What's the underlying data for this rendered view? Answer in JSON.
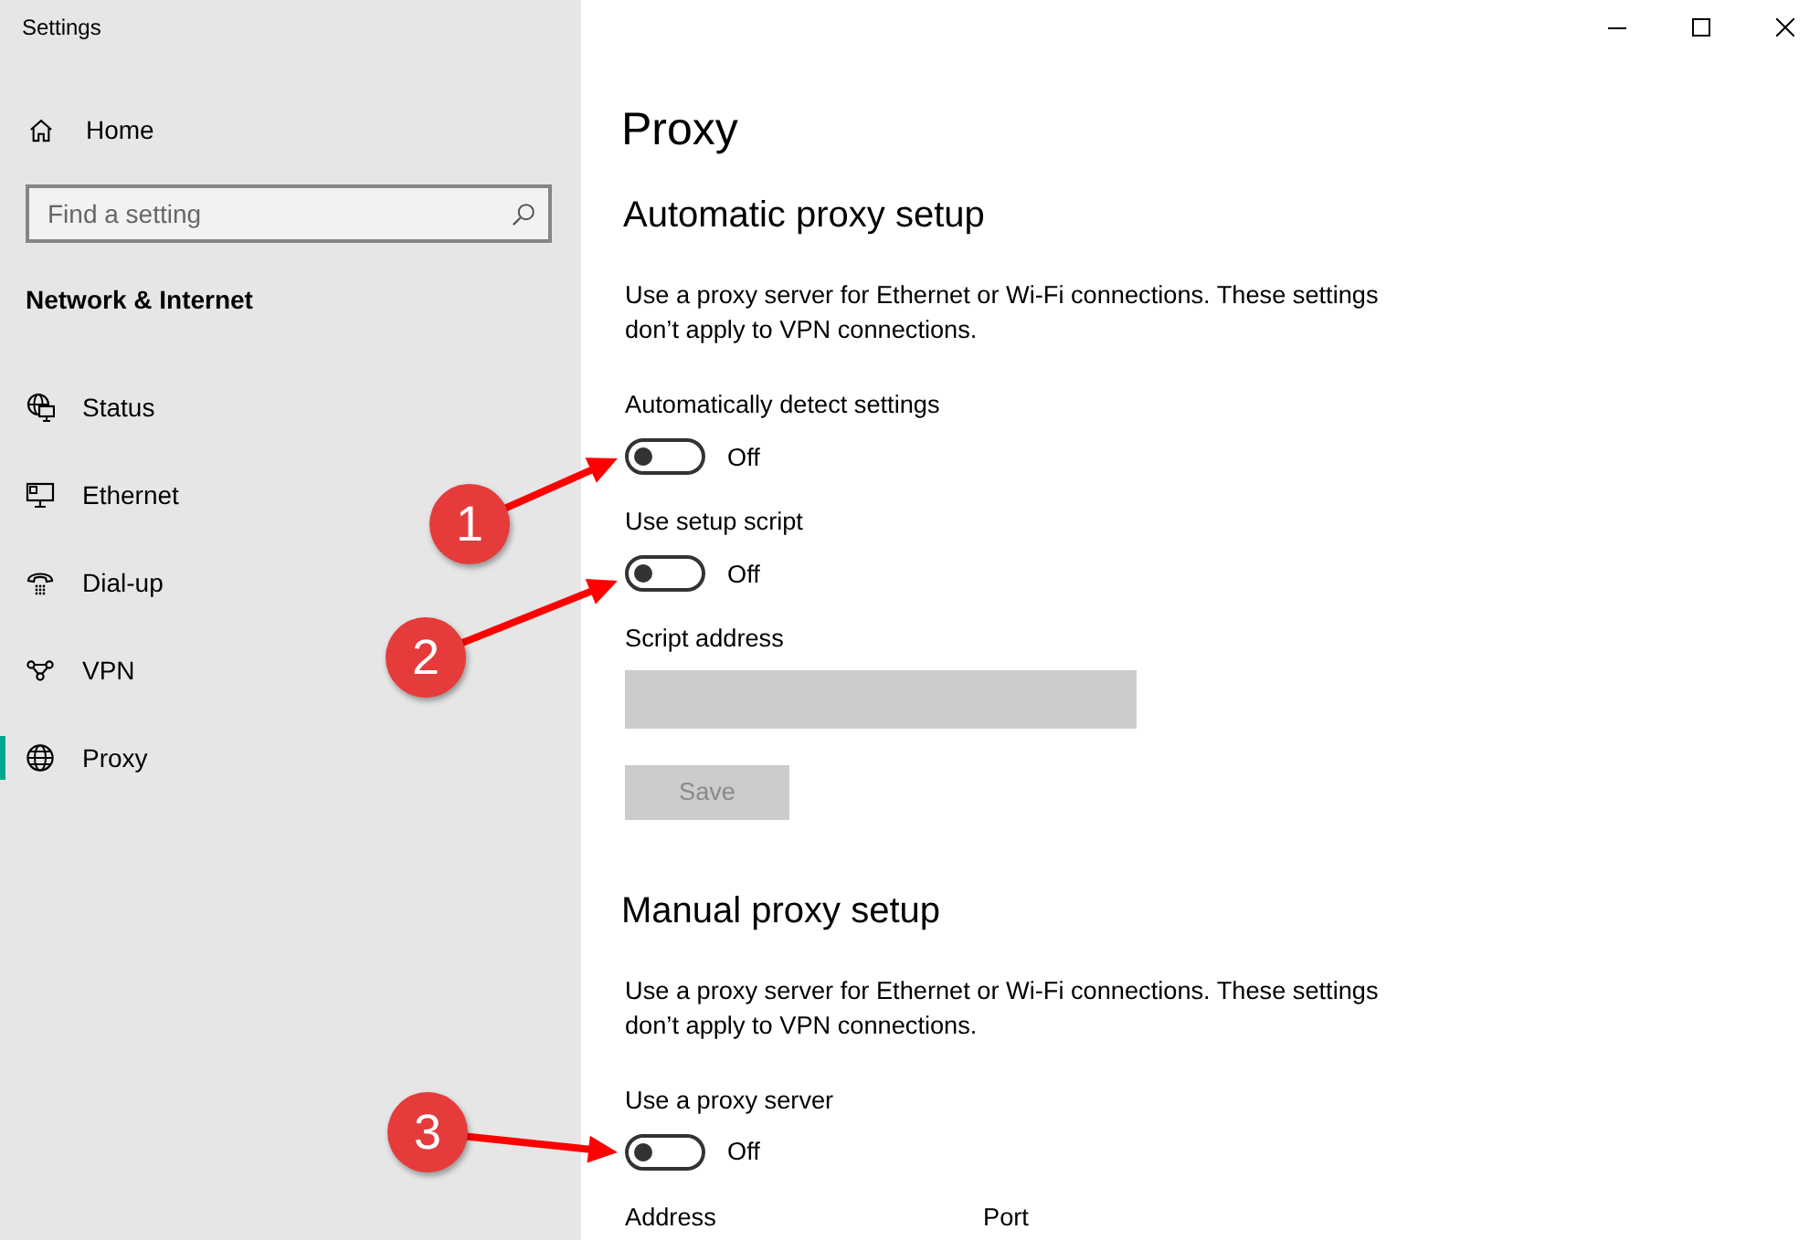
{
  "window": {
    "title": "Settings"
  },
  "sidebar": {
    "home": {
      "label": "Home"
    },
    "search": {
      "placeholder": "Find a setting"
    },
    "section_title": "Network & Internet",
    "items": [
      {
        "kind": "status",
        "label": "Status",
        "selected": false
      },
      {
        "kind": "ethernet",
        "label": "Ethernet",
        "selected": false
      },
      {
        "kind": "dialup",
        "label": "Dial-up",
        "selected": false
      },
      {
        "kind": "vpn",
        "label": "VPN",
        "selected": false
      },
      {
        "kind": "proxy",
        "label": "Proxy",
        "selected": true
      }
    ]
  },
  "main": {
    "title": "Proxy",
    "sections": [
      {
        "heading": "Automatic proxy setup",
        "description": "Use a proxy server for Ethernet or Wi-Fi connections. These settings don’t apply to VPN connections.",
        "controls": [
          {
            "kind": "toggle",
            "label": "Automatically detect settings",
            "on": false,
            "state_text": "Off"
          },
          {
            "kind": "toggle",
            "label": "Use setup script",
            "on": false,
            "state_text": "Off"
          },
          {
            "kind": "text_field",
            "label": "Script address",
            "disabled": true
          },
          {
            "kind": "button",
            "label": "Save",
            "disabled": true
          }
        ]
      },
      {
        "heading": "Manual proxy setup",
        "description": "Use a proxy server for Ethernet or Wi-Fi connections. These settings don’t apply to VPN connections.",
        "controls": [
          {
            "kind": "toggle",
            "label": "Use a proxy server",
            "on": false,
            "state_text": "Off"
          },
          {
            "kind": "field_labels",
            "labels": [
              "Address",
              "Port"
            ]
          }
        ]
      }
    ]
  },
  "annotations": [
    {
      "label": "1"
    },
    {
      "label": "2"
    },
    {
      "label": "3"
    }
  ]
}
